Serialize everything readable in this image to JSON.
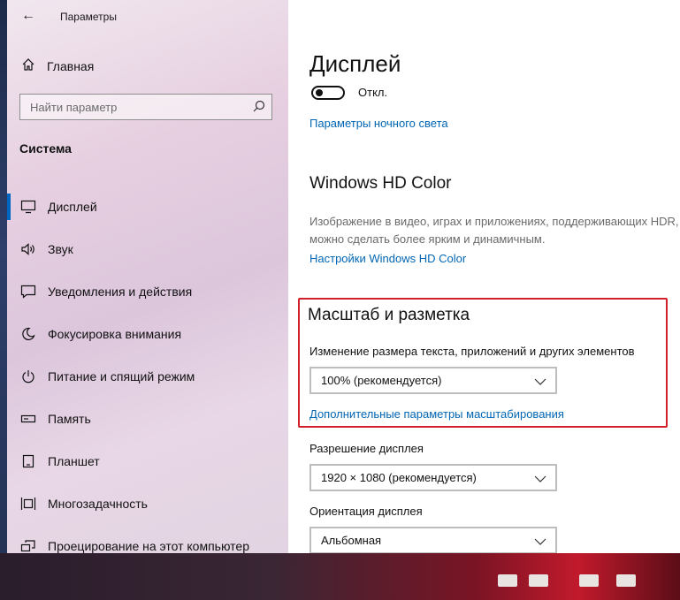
{
  "window": {
    "app_title": "Параметры"
  },
  "sidebar": {
    "home_label": "Главная",
    "search_placeholder": "Найти параметр",
    "section_title": "Система",
    "items": [
      {
        "label": "Дисплей",
        "icon": "monitor-icon",
        "active": true
      },
      {
        "label": "Звук",
        "icon": "speaker-icon"
      },
      {
        "label": "Уведомления и действия",
        "icon": "notification-icon"
      },
      {
        "label": "Фокусировка внимания",
        "icon": "moon-icon"
      },
      {
        "label": "Питание и спящий режим",
        "icon": "power-icon"
      },
      {
        "label": "Память",
        "icon": "storage-icon"
      },
      {
        "label": "Планшет",
        "icon": "tablet-icon"
      },
      {
        "label": "Многозадачность",
        "icon": "multitasking-icon"
      },
      {
        "label": "Проецирование на этот компьютер",
        "icon": "projecting-icon"
      }
    ]
  },
  "main": {
    "title": "Дисплей",
    "night_light_state": "Откл.",
    "night_light_link": "Параметры ночного света",
    "hd_color": {
      "title": "Windows HD Color",
      "description": "Изображение в видео, играх и приложениях, поддерживающих HDR, можно сделать более ярким и динамичным.",
      "link": "Настройки Windows HD Color"
    },
    "scale": {
      "title": "Масштаб и разметка",
      "label": "Изменение размера текста, приложений и других элементов",
      "value": "100% (рекомендуется)",
      "link": "Дополнительные параметры масштабирования"
    },
    "resolution": {
      "label": "Разрешение дисплея",
      "value": "1920 × 1080 (рекомендуется)"
    },
    "orientation": {
      "label": "Ориентация дисплея",
      "value": "Альбомная"
    }
  },
  "colors": {
    "accent": "#0066b4",
    "highlight": "#d0202a"
  }
}
